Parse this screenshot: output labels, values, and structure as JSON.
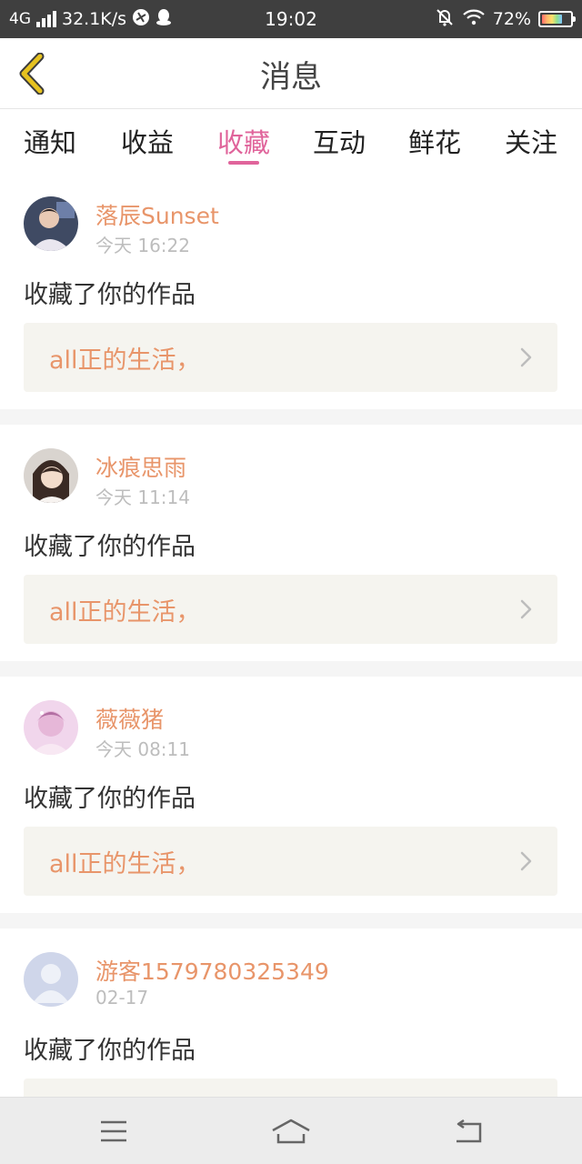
{
  "status_bar": {
    "network": "4G",
    "speed": "32.1K/s",
    "time": "19:02",
    "battery": "72%",
    "battery_level": 0.72
  },
  "header": {
    "title": "消息"
  },
  "tabs": [
    {
      "label": "通知",
      "active": false
    },
    {
      "label": "收益",
      "active": false
    },
    {
      "label": "收藏",
      "active": true
    },
    {
      "label": "互动",
      "active": false
    },
    {
      "label": "鲜花",
      "active": false
    },
    {
      "label": "关注",
      "active": false
    }
  ],
  "feed": [
    {
      "username": "落辰Sunset",
      "time": "今天 16:22",
      "action": "收藏了你的作品",
      "work_title": "all正的生活，"
    },
    {
      "username": "冰痕思雨",
      "time": "今天 11:14",
      "action": "收藏了你的作品",
      "work_title": "all正的生活，"
    },
    {
      "username": "薇薇猪",
      "time": "今天 08:11",
      "action": "收藏了你的作品",
      "work_title": "all正的生活，"
    },
    {
      "username": "游客1579780325349",
      "time": "02-17",
      "action": "收藏了你的作品",
      "work_title": ""
    }
  ],
  "colors": {
    "accent": "#e0649b",
    "username": "#e8956a",
    "status_bar_bg": "#3f3f3f",
    "back_arrow": "#e6c21f"
  },
  "icons": {
    "back": "chevron-left-icon",
    "work_arrow": "chevron-right-icon",
    "nav_menu": "menu-icon",
    "nav_home": "home-icon",
    "nav_back": "return-icon"
  }
}
